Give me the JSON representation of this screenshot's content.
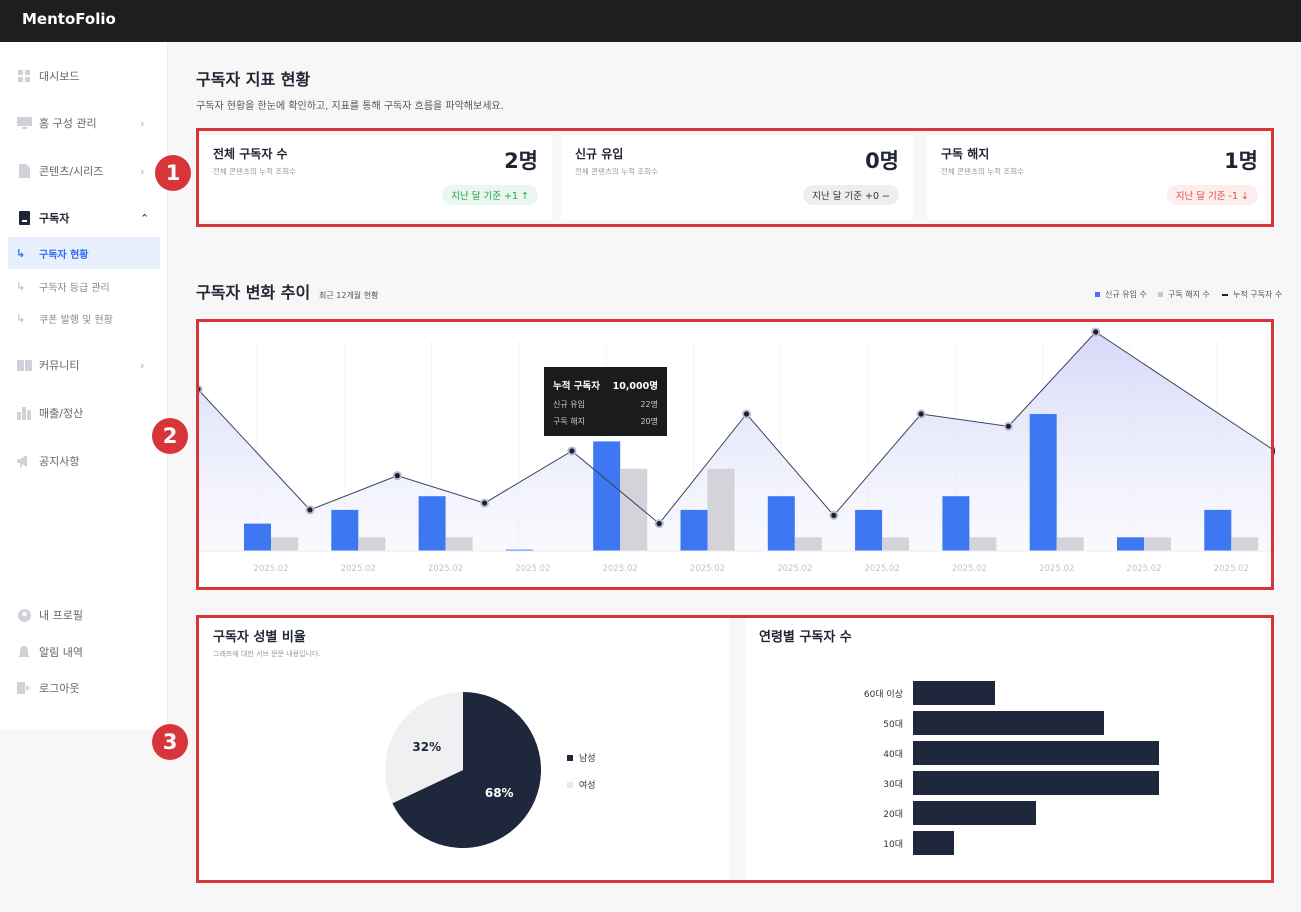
{
  "app": {
    "title": "MentoFolio"
  },
  "sidebar": {
    "items": [
      {
        "label": "대시보드",
        "icon": "grid-icon"
      },
      {
        "label": "홈 구성 관리",
        "icon": "monitor-icon"
      },
      {
        "label": "콘텐츠/시리즈",
        "icon": "document-icon"
      },
      {
        "label": "구독자",
        "icon": "subscriber-icon"
      },
      {
        "label": "커뮤니티",
        "icon": "book-icon"
      },
      {
        "label": "매출/정산",
        "icon": "bar-chart-icon"
      },
      {
        "label": "공지사항",
        "icon": "megaphone-icon"
      }
    ],
    "subitems": [
      {
        "label": "구독자 현황"
      },
      {
        "label": "구독자 등급 관리"
      },
      {
        "label": "쿠폰 발행 및 현황"
      }
    ],
    "bottom": [
      {
        "label": "내 프로필",
        "icon": "profile-icon"
      },
      {
        "label": "알림 내역",
        "icon": "bell-icon"
      },
      {
        "label": "로그아웃",
        "icon": "logout-icon"
      }
    ]
  },
  "page": {
    "title": "구독자 지표 현황",
    "desc": "구독자 현황을 한눈에 확인하고, 지표를 통해 구독자 흐름을 파악해보세요."
  },
  "cards": [
    {
      "title": "전체 구독자 수",
      "sub": "전체 콘텐츠의 누적 조회수",
      "value": "2명",
      "badge": "지난 달 기준 +1 ↑"
    },
    {
      "title": "신규 유입",
      "sub": "전체 콘텐츠의 누적 조회수",
      "value": "0명",
      "badge": "지난 달 기준 +0 −"
    },
    {
      "title": "구독 해지",
      "sub": "전체 콘텐츠의 누적 조회수",
      "value": "1명",
      "badge": "지난 달 기준 -1 ↓"
    }
  ],
  "markers": [
    "1",
    "2",
    "3"
  ],
  "trend": {
    "title": "구독자 변화 추이",
    "subtitle": "최근 12개월 현황",
    "legend": [
      "신규 유입 수",
      "구독 해지 수",
      "누적 구독자 수"
    ]
  },
  "tooltip": {
    "title": "누적 구독자",
    "title_value": "10,000명",
    "rows": [
      {
        "label": "신규 유입",
        "value": "22명"
      },
      {
        "label": "구독 해지",
        "value": "20명"
      }
    ]
  },
  "chart_data": [
    {
      "type": "bar",
      "categories": [
        "2025.02",
        "2025.02",
        "2025.02",
        "2025.02",
        "2025.02",
        "2025.02",
        "2025.02",
        "2025.02",
        "2025.02",
        "2025.02",
        "2025.02",
        "2025.02"
      ],
      "series": [
        {
          "name": "신규 유입 수",
          "values": [
            2,
            3,
            4,
            0.1,
            8,
            3,
            4,
            3,
            4,
            10,
            1,
            3
          ],
          "color": "#3d78f2"
        },
        {
          "name": "구독 해지 수",
          "values": [
            1,
            1,
            1,
            0.05,
            6,
            6,
            1,
            1,
            1,
            1,
            1,
            1
          ],
          "color": "#d3d3d9"
        },
        {
          "name": "누적 구독자 수",
          "values": [
            11.8,
            3,
            5.5,
            3.5,
            7.3,
            2.0,
            10,
            2.6,
            10,
            9.1,
            16,
            7.3
          ],
          "color": "#3b4060"
        }
      ]
    },
    {
      "type": "pie",
      "title": "구독자 성별 비율",
      "subtitle": "그래프에 대한 서브 문문 내용입니다.",
      "labels": [
        "남성",
        "여성"
      ],
      "values": [
        68,
        32
      ],
      "display": [
        "68%",
        "32%"
      ],
      "colors": [
        "#1e273b",
        "#f0f0f2"
      ]
    },
    {
      "type": "bar",
      "orientation": "horizontal",
      "title": "연령별 구독자 수",
      "categories": [
        "60대 이상",
        "50대",
        "40대",
        "30대",
        "20대",
        "10대"
      ],
      "values": [
        3,
        7,
        9,
        9,
        4.5,
        1.5
      ]
    }
  ]
}
